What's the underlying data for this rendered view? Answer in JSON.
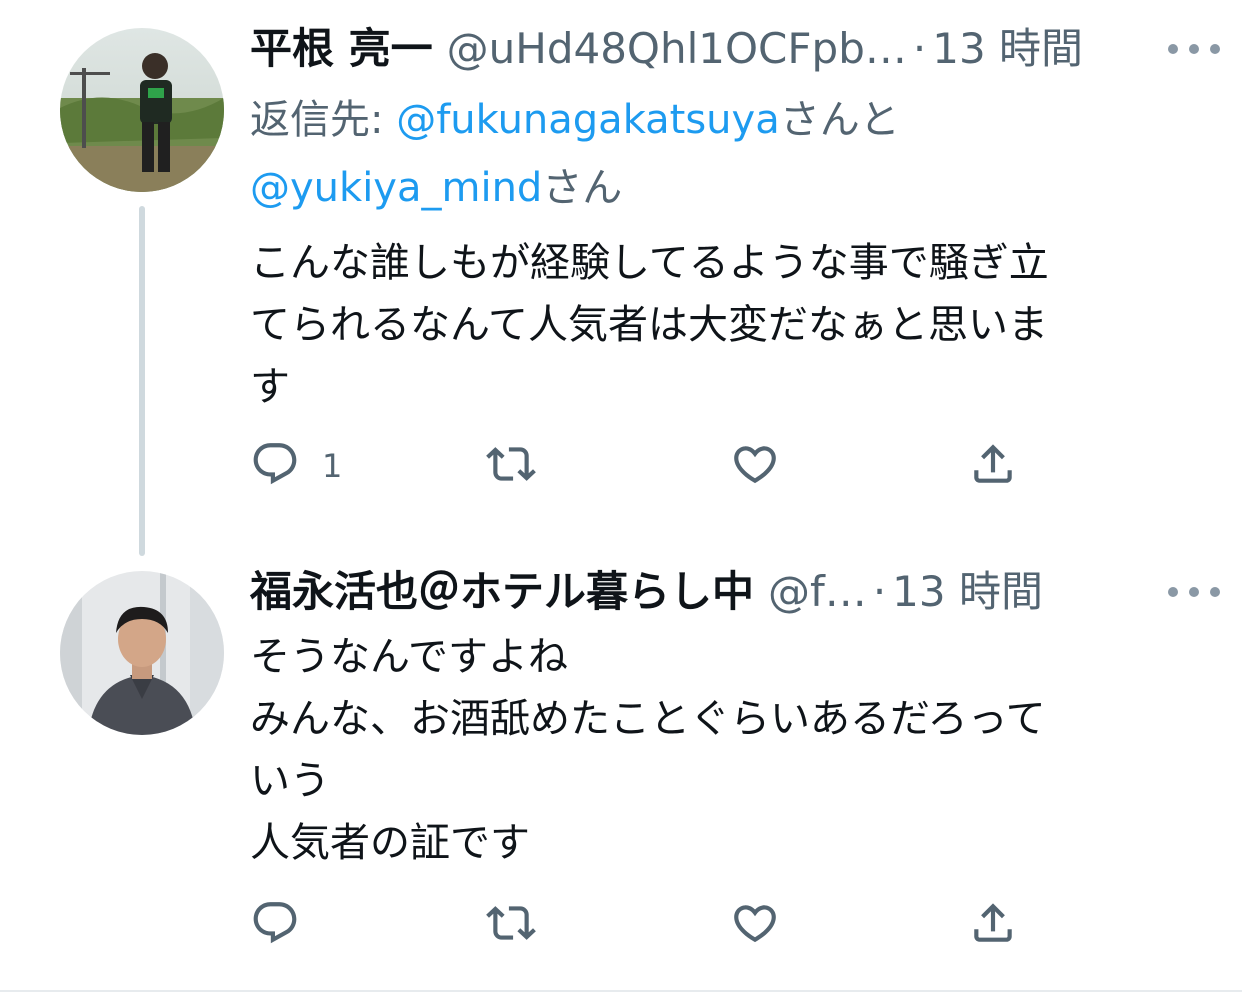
{
  "tweets": [
    {
      "author_name": "平根 亮一",
      "handle": "@uHd48Qhl1OCFpb…",
      "dot": "·",
      "time": "13 時間",
      "reply_prefix": "返信先: ",
      "reply_mention_1": "@fukunagakatsuya",
      "reply_connector": "さんと",
      "reply_mention_2": "@yukiya_mind",
      "reply_suffix": "さん",
      "body_lines": [
        "こんな誰しもが経験してるような事で騒ぎ立",
        "てられるなんて人気者は大変だなぁと思いま",
        "す"
      ],
      "reply_count": "1",
      "actions": {
        "reply": "reply-icon",
        "retweet": "retweet-icon",
        "like": "heart-icon",
        "share": "share-icon"
      }
    },
    {
      "author_name": "福永活也＠ホテル暮らし中",
      "handle": "@f…",
      "dot": "·",
      "time": "13 時間",
      "body_lines": [
        "そうなんですよね",
        "みんな、お酒舐めたことぐらいあるだろって",
        "いう",
        "人気者の証です"
      ],
      "reply_count": "",
      "actions": {
        "reply": "reply-icon",
        "retweet": "retweet-icon",
        "like": "heart-icon",
        "share": "share-icon"
      }
    }
  ],
  "colors": {
    "text": "#0f1419",
    "secondary": "#536471",
    "link": "#1d9bf0",
    "thread_line": "#cfd9de"
  }
}
